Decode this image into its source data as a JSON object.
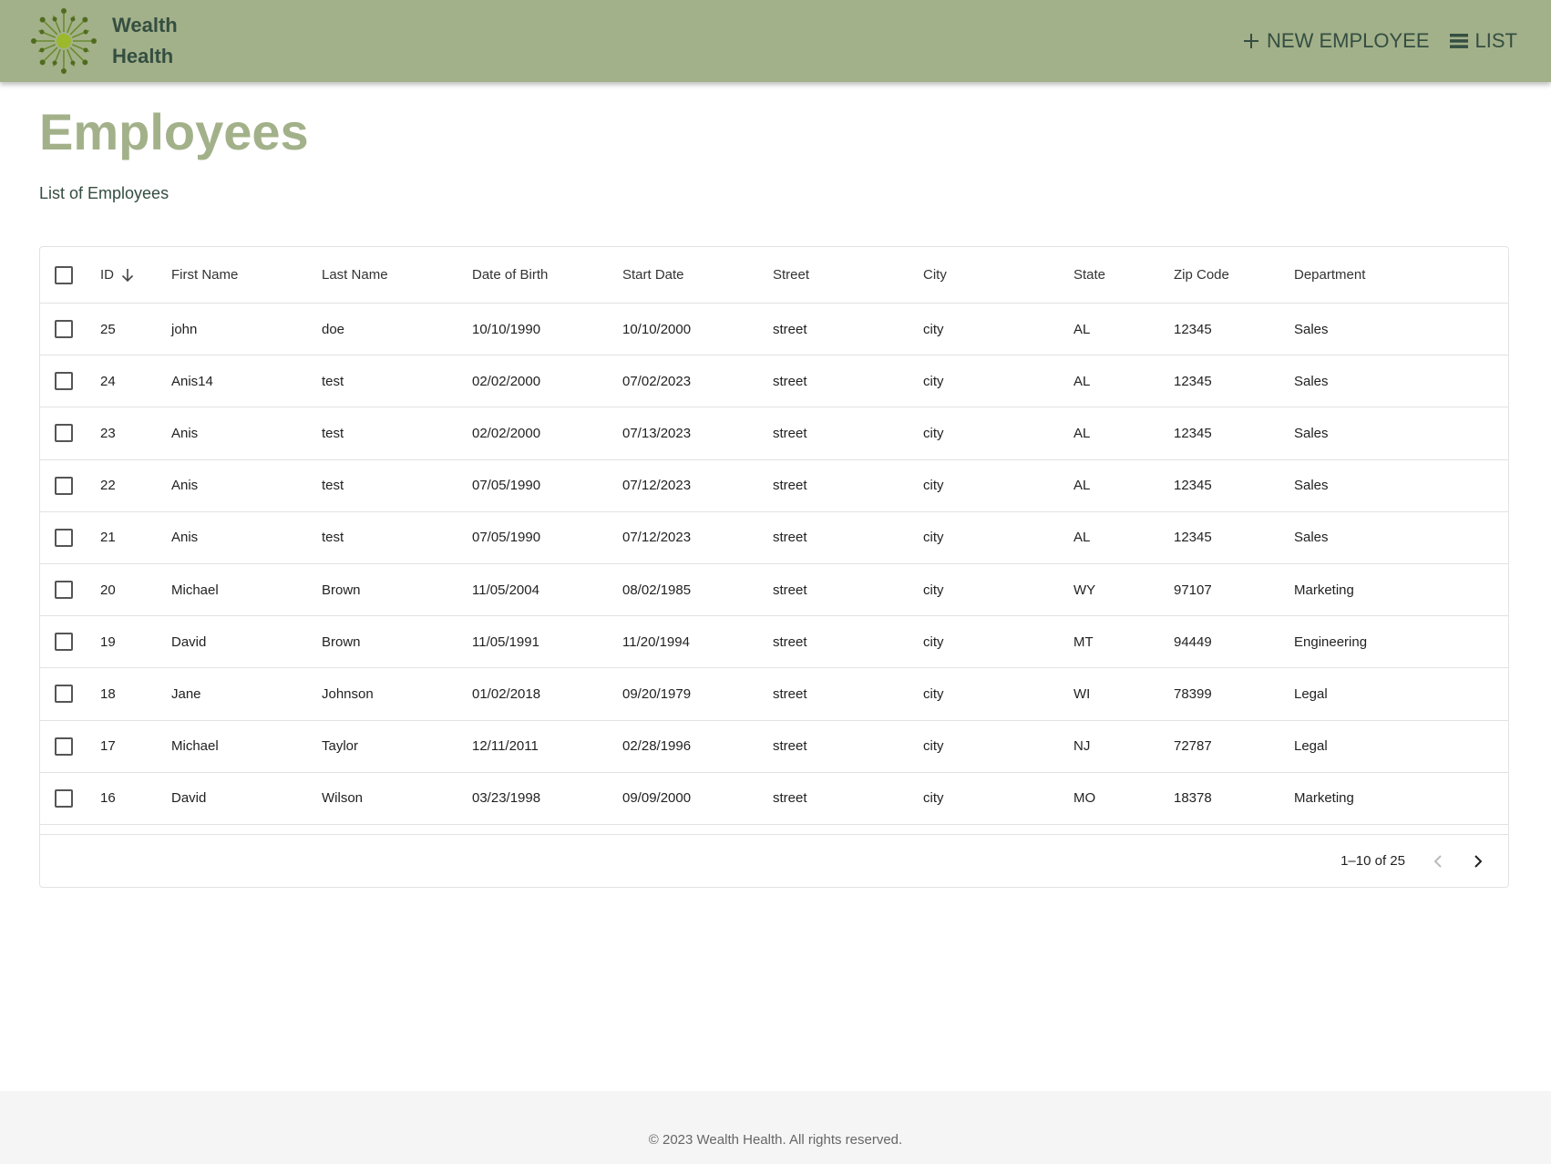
{
  "brand": {
    "line1": "Wealth",
    "line2": "Health"
  },
  "nav": {
    "new_employee": "NEW EMPLOYEE",
    "list": "LIST"
  },
  "page": {
    "title": "Employees",
    "subtitle": "List of Employees"
  },
  "table": {
    "columns": [
      "ID",
      "First Name",
      "Last Name",
      "Date of Birth",
      "Start Date",
      "Street",
      "City",
      "State",
      "Zip Code",
      "Department"
    ],
    "rows": [
      [
        "25",
        "john",
        "doe",
        "10/10/1990",
        "10/10/2000",
        "street",
        "city",
        "AL",
        "12345",
        "Sales"
      ],
      [
        "24",
        "Anis14",
        "test",
        "02/02/2000",
        "07/02/2023",
        "street",
        "city",
        "AL",
        "12345",
        "Sales"
      ],
      [
        "23",
        "Anis",
        "test",
        "02/02/2000",
        "07/13/2023",
        "street",
        "city",
        "AL",
        "12345",
        "Sales"
      ],
      [
        "22",
        "Anis",
        "test",
        "07/05/1990",
        "07/12/2023",
        "street",
        "city",
        "AL",
        "12345",
        "Sales"
      ],
      [
        "21",
        "Anis",
        "test",
        "07/05/1990",
        "07/12/2023",
        "street",
        "city",
        "AL",
        "12345",
        "Sales"
      ],
      [
        "20",
        "Michael",
        "Brown",
        "11/05/2004",
        "08/02/1985",
        "street",
        "city",
        "WY",
        "97107",
        "Marketing"
      ],
      [
        "19",
        "David",
        "Brown",
        "11/05/1991",
        "11/20/1994",
        "street",
        "city",
        "MT",
        "94449",
        "Engineering"
      ],
      [
        "18",
        "Jane",
        "Johnson",
        "01/02/2018",
        "09/20/1979",
        "street",
        "city",
        "WI",
        "78399",
        "Legal"
      ],
      [
        "17",
        "Michael",
        "Taylor",
        "12/11/2011",
        "02/28/1996",
        "street",
        "city",
        "NJ",
        "72787",
        "Legal"
      ],
      [
        "16",
        "David",
        "Wilson",
        "03/23/1998",
        "09/09/2000",
        "street",
        "city",
        "MO",
        "18378",
        "Marketing"
      ]
    ],
    "pagination": "1–10 of 25"
  },
  "footer": {
    "text": "© 2023 Wealth Health. All rights reserved."
  },
  "colors": {
    "header_bg": "#a3b18a",
    "brand_dark": "#344e41",
    "title": "#a3b18a"
  },
  "icons": {
    "logo": "sunburst-logo-icon",
    "plus": "plus-icon",
    "list": "list-icon",
    "sort": "arrow-down-icon",
    "prev": "chevron-left-icon",
    "next": "chevron-right-icon"
  }
}
